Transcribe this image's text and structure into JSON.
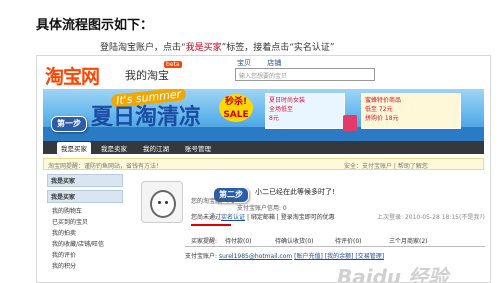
{
  "heading": "具体流程图示如下：",
  "caption": {
    "prefix": "登陆淘宝账户，点击“",
    "highlight": "我是买家",
    "suffix": "”标签，接着点击“实名认证”"
  },
  "screenshot": {
    "logo": "淘宝网",
    "logo_sub": "我的淘宝",
    "logo_badge": "beta",
    "top_tabs": [
      "宝贝",
      "店铺"
    ],
    "search_placeholder": "输入您想要的宝贝",
    "banner": {
      "tag": "It's summer",
      "title": "夏日淘清凉",
      "sale": "秒杀! SALE",
      "promo1_line1": "夏日时尚女装",
      "promo1_line2": "全场低至",
      "promo1_line3": "8元",
      "promo2_line1": "蜜蜂特价商品",
      "promo2_line2": "低至 72元",
      "promo2_line3": "拼购价 18元"
    },
    "nav": [
      "我是买家",
      "我是卖家",
      "我的江湖",
      "账号管理"
    ],
    "notice_left": "淘宝网提醒：谨防钓鱼网站，省钱有方法！",
    "notice_right": "安全：支付宝账户 | 帮助了解您",
    "sidebar": {
      "head1": "我是买家",
      "head2": "我是买家",
      "items": [
        "我的购物车",
        "已买到的宝贝",
        "我的拍卖",
        "我的收藏/店铺/旺信",
        "我的评价",
        "我的积分"
      ]
    },
    "avatar_label": "更新头像",
    "message": "小二已经在此等候多时了!",
    "content_lines": [
      "您的淘宝账户: 1",
      "支付宝账户信用: 0"
    ],
    "status_prefix": "您尚未通过",
    "status_link": "实名认证",
    "status_mid": "| 绑定邮箱 | 登录淘宝即可的优惠",
    "last_login": "上次登录: 2010-05-28 18:15(不是我?)",
    "subtabs": [
      "买家提醒:",
      "待付款(0)",
      "待确认收货(0)",
      "待评价(0)",
      "三个月商家(2)"
    ],
    "pay_label": "支付宝账户:",
    "pay_email": "surel1985@hotmail.com",
    "pay_links": "[账户充值] [我的余额] [交易管理]",
    "step1": "第一步",
    "step2": "第二步",
    "watermark": "Baidu 经验"
  }
}
